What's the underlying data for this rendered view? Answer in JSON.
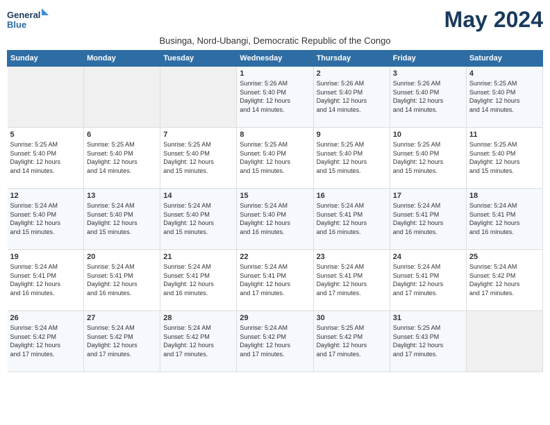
{
  "logo": {
    "line1": "General",
    "line2": "Blue"
  },
  "month_title": "May 2024",
  "subtitle": "Businga, Nord-Ubangi, Democratic Republic of the Congo",
  "headers": [
    "Sunday",
    "Monday",
    "Tuesday",
    "Wednesday",
    "Thursday",
    "Friday",
    "Saturday"
  ],
  "weeks": [
    [
      {
        "day": "",
        "info": ""
      },
      {
        "day": "",
        "info": ""
      },
      {
        "day": "",
        "info": ""
      },
      {
        "day": "1",
        "info": "Sunrise: 5:26 AM\nSunset: 5:40 PM\nDaylight: 12 hours\nand 14 minutes."
      },
      {
        "day": "2",
        "info": "Sunrise: 5:26 AM\nSunset: 5:40 PM\nDaylight: 12 hours\nand 14 minutes."
      },
      {
        "day": "3",
        "info": "Sunrise: 5:26 AM\nSunset: 5:40 PM\nDaylight: 12 hours\nand 14 minutes."
      },
      {
        "day": "4",
        "info": "Sunrise: 5:25 AM\nSunset: 5:40 PM\nDaylight: 12 hours\nand 14 minutes."
      }
    ],
    [
      {
        "day": "5",
        "info": "Sunrise: 5:25 AM\nSunset: 5:40 PM\nDaylight: 12 hours\nand 14 minutes."
      },
      {
        "day": "6",
        "info": "Sunrise: 5:25 AM\nSunset: 5:40 PM\nDaylight: 12 hours\nand 14 minutes."
      },
      {
        "day": "7",
        "info": "Sunrise: 5:25 AM\nSunset: 5:40 PM\nDaylight: 12 hours\nand 15 minutes."
      },
      {
        "day": "8",
        "info": "Sunrise: 5:25 AM\nSunset: 5:40 PM\nDaylight: 12 hours\nand 15 minutes."
      },
      {
        "day": "9",
        "info": "Sunrise: 5:25 AM\nSunset: 5:40 PM\nDaylight: 12 hours\nand 15 minutes."
      },
      {
        "day": "10",
        "info": "Sunrise: 5:25 AM\nSunset: 5:40 PM\nDaylight: 12 hours\nand 15 minutes."
      },
      {
        "day": "11",
        "info": "Sunrise: 5:25 AM\nSunset: 5:40 PM\nDaylight: 12 hours\nand 15 minutes."
      }
    ],
    [
      {
        "day": "12",
        "info": "Sunrise: 5:24 AM\nSunset: 5:40 PM\nDaylight: 12 hours\nand 15 minutes."
      },
      {
        "day": "13",
        "info": "Sunrise: 5:24 AM\nSunset: 5:40 PM\nDaylight: 12 hours\nand 15 minutes."
      },
      {
        "day": "14",
        "info": "Sunrise: 5:24 AM\nSunset: 5:40 PM\nDaylight: 12 hours\nand 15 minutes."
      },
      {
        "day": "15",
        "info": "Sunrise: 5:24 AM\nSunset: 5:40 PM\nDaylight: 12 hours\nand 16 minutes."
      },
      {
        "day": "16",
        "info": "Sunrise: 5:24 AM\nSunset: 5:41 PM\nDaylight: 12 hours\nand 16 minutes."
      },
      {
        "day": "17",
        "info": "Sunrise: 5:24 AM\nSunset: 5:41 PM\nDaylight: 12 hours\nand 16 minutes."
      },
      {
        "day": "18",
        "info": "Sunrise: 5:24 AM\nSunset: 5:41 PM\nDaylight: 12 hours\nand 16 minutes."
      }
    ],
    [
      {
        "day": "19",
        "info": "Sunrise: 5:24 AM\nSunset: 5:41 PM\nDaylight: 12 hours\nand 16 minutes."
      },
      {
        "day": "20",
        "info": "Sunrise: 5:24 AM\nSunset: 5:41 PM\nDaylight: 12 hours\nand 16 minutes."
      },
      {
        "day": "21",
        "info": "Sunrise: 5:24 AM\nSunset: 5:41 PM\nDaylight: 12 hours\nand 16 minutes."
      },
      {
        "day": "22",
        "info": "Sunrise: 5:24 AM\nSunset: 5:41 PM\nDaylight: 12 hours\nand 17 minutes."
      },
      {
        "day": "23",
        "info": "Sunrise: 5:24 AM\nSunset: 5:41 PM\nDaylight: 12 hours\nand 17 minutes."
      },
      {
        "day": "24",
        "info": "Sunrise: 5:24 AM\nSunset: 5:41 PM\nDaylight: 12 hours\nand 17 minutes."
      },
      {
        "day": "25",
        "info": "Sunrise: 5:24 AM\nSunset: 5:42 PM\nDaylight: 12 hours\nand 17 minutes."
      }
    ],
    [
      {
        "day": "26",
        "info": "Sunrise: 5:24 AM\nSunset: 5:42 PM\nDaylight: 12 hours\nand 17 minutes."
      },
      {
        "day": "27",
        "info": "Sunrise: 5:24 AM\nSunset: 5:42 PM\nDaylight: 12 hours\nand 17 minutes."
      },
      {
        "day": "28",
        "info": "Sunrise: 5:24 AM\nSunset: 5:42 PM\nDaylight: 12 hours\nand 17 minutes."
      },
      {
        "day": "29",
        "info": "Sunrise: 5:24 AM\nSunset: 5:42 PM\nDaylight: 12 hours\nand 17 minutes."
      },
      {
        "day": "30",
        "info": "Sunrise: 5:25 AM\nSunset: 5:42 PM\nDaylight: 12 hours\nand 17 minutes."
      },
      {
        "day": "31",
        "info": "Sunrise: 5:25 AM\nSunset: 5:43 PM\nDaylight: 12 hours\nand 17 minutes."
      },
      {
        "day": "",
        "info": ""
      }
    ]
  ]
}
